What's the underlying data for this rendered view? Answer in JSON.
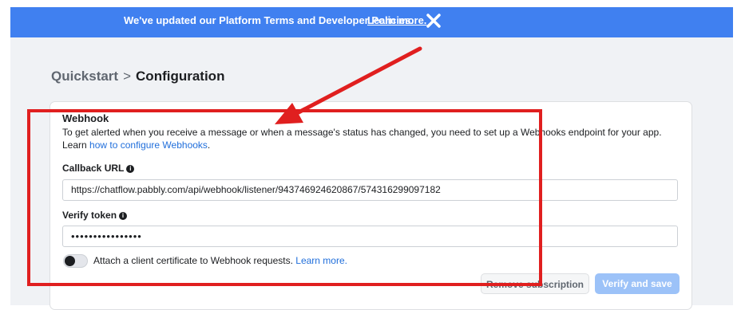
{
  "banner": {
    "text": "We've updated our Platform Terms and Developer Policies.",
    "link": "Learn more.",
    "close_icon": "close-x-icon"
  },
  "breadcrumb": {
    "parent": "Quickstart",
    "separator": ">",
    "current": "Configuration"
  },
  "webhook": {
    "title": "Webhook",
    "description": "To get alerted when you receive a message or when a message's status has changed, you need to set up a Webhooks endpoint for your app. Learn",
    "description_link": "how to configure Webhooks",
    "description_end": ".",
    "callback_label": "Callback URL",
    "callback_value": "https://chatflow.pabbly.com/api/webhook/listener/943746924620867/574316299097182",
    "verify_label": "Verify token",
    "verify_value": "••••••••••••••••",
    "info_icon": "info-icon",
    "toggle_text": "Attach a client certificate to Webhook requests.",
    "toggle_link": "Learn more.",
    "toggle_on": false,
    "remove_button": "Remove subscription",
    "verify_button": "Verify and save"
  },
  "colors": {
    "banner": "#4080f0",
    "link": "#216fdb",
    "annotation": "#e01f1f",
    "background": "#f0f2f5"
  }
}
